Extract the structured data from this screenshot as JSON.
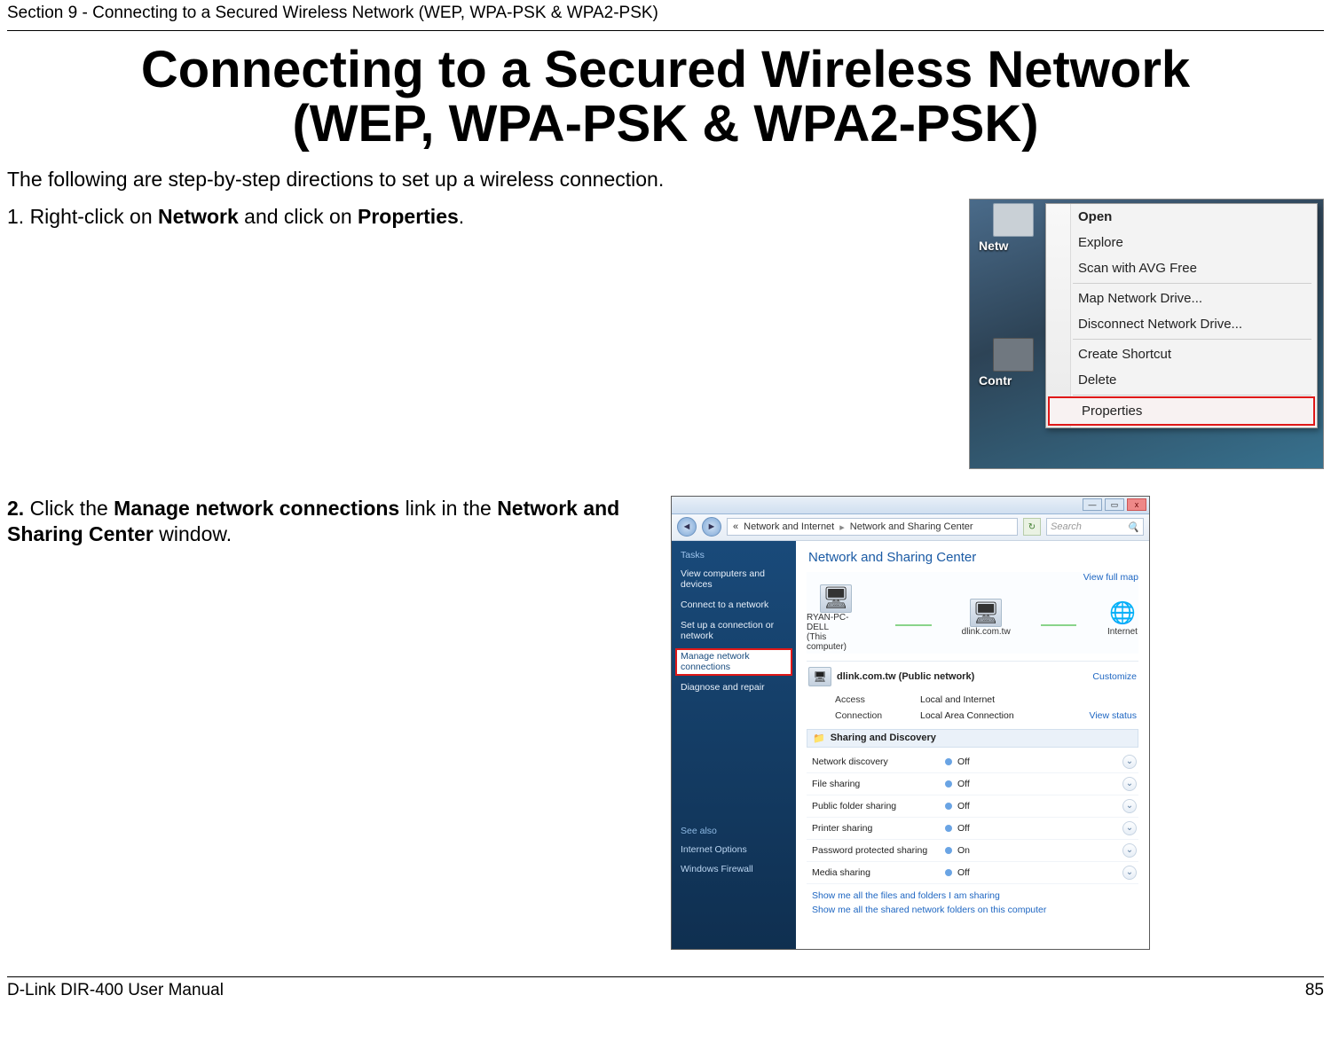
{
  "header": {
    "section_line": "Section 9 - Connecting to a Secured Wireless Network (WEP, WPA-PSK & WPA2-PSK)"
  },
  "title": {
    "line1": "Connecting to a Secured Wireless Network",
    "line2": "(WEP, WPA-PSK & WPA2-PSK)"
  },
  "intro": "The following are step-by-step directions to set up a wireless connection.",
  "step1": {
    "pre": "1. Right-click on ",
    "b1": "Network",
    "mid": " and click on ",
    "b2": "Properties",
    "post": "."
  },
  "step2": {
    "pre": "2. ",
    "mid1": "Click the ",
    "b1": "Manage network connections",
    "mid2": " link in the ",
    "b2": "Network and Sharing Center",
    "post": " window."
  },
  "fig1": {
    "desk_label1": "Netw",
    "desk_label2": "Contr",
    "menu": {
      "open": "Open",
      "explore": "Explore",
      "scan": "Scan with AVG Free",
      "map": "Map Network Drive...",
      "disconnect": "Disconnect Network Drive...",
      "shortcut": "Create Shortcut",
      "delete": "Delete",
      "properties": "Properties"
    }
  },
  "fig2": {
    "win": {
      "min": "—",
      "max": "▭",
      "close": "x"
    },
    "toolbar": {
      "back": "◄",
      "fwd": "►",
      "crumb_icon": "«",
      "crumb1": "Network and Internet",
      "crumb2": "Network and Sharing Center",
      "refresh": "↻",
      "search_placeholder": "Search",
      "search_icon": "🔍"
    },
    "sidebar": {
      "tasks_hdr": "Tasks",
      "items": [
        "View computers and devices",
        "Connect to a network",
        "Set up a connection or network",
        "Manage network connections",
        "Diagnose and repair"
      ],
      "see_also": "See also",
      "also_items": [
        "Internet Options",
        "Windows Firewall"
      ]
    },
    "main": {
      "title": "Network and Sharing Center",
      "view_full_map": "View full map",
      "nodes": {
        "pc": "RYAN-PC-DELL",
        "pc_sub": "(This computer)",
        "gw": "dlink.com.tw",
        "inet": "Internet"
      },
      "network": {
        "name": "dlink.com.tw (Public network)",
        "customize": "Customize",
        "access_k": "Access",
        "access_v": "Local and Internet",
        "conn_k": "Connection",
        "conn_v": "Local Area Connection",
        "view_status": "View status"
      },
      "sharing_hdr": "Sharing and Discovery",
      "rows": [
        {
          "label": "Network discovery",
          "value": "Off"
        },
        {
          "label": "File sharing",
          "value": "Off"
        },
        {
          "label": "Public folder sharing",
          "value": "Off"
        },
        {
          "label": "Printer sharing",
          "value": "Off"
        },
        {
          "label": "Password protected sharing",
          "value": "On"
        },
        {
          "label": "Media sharing",
          "value": "Off"
        }
      ],
      "links": {
        "l1": "Show me all the files and folders I am sharing",
        "l2": "Show me all the shared network folders on this computer"
      }
    }
  },
  "footer": {
    "left": "D-Link DIR-400 User Manual",
    "right": "85"
  },
  "icons": {
    "cursor": "↖",
    "chevron_down": "⌄",
    "bullet": "◉",
    "globe": "🌐",
    "monitor": "🖥",
    "folder": "📁",
    "arrow_sep": "▸"
  }
}
